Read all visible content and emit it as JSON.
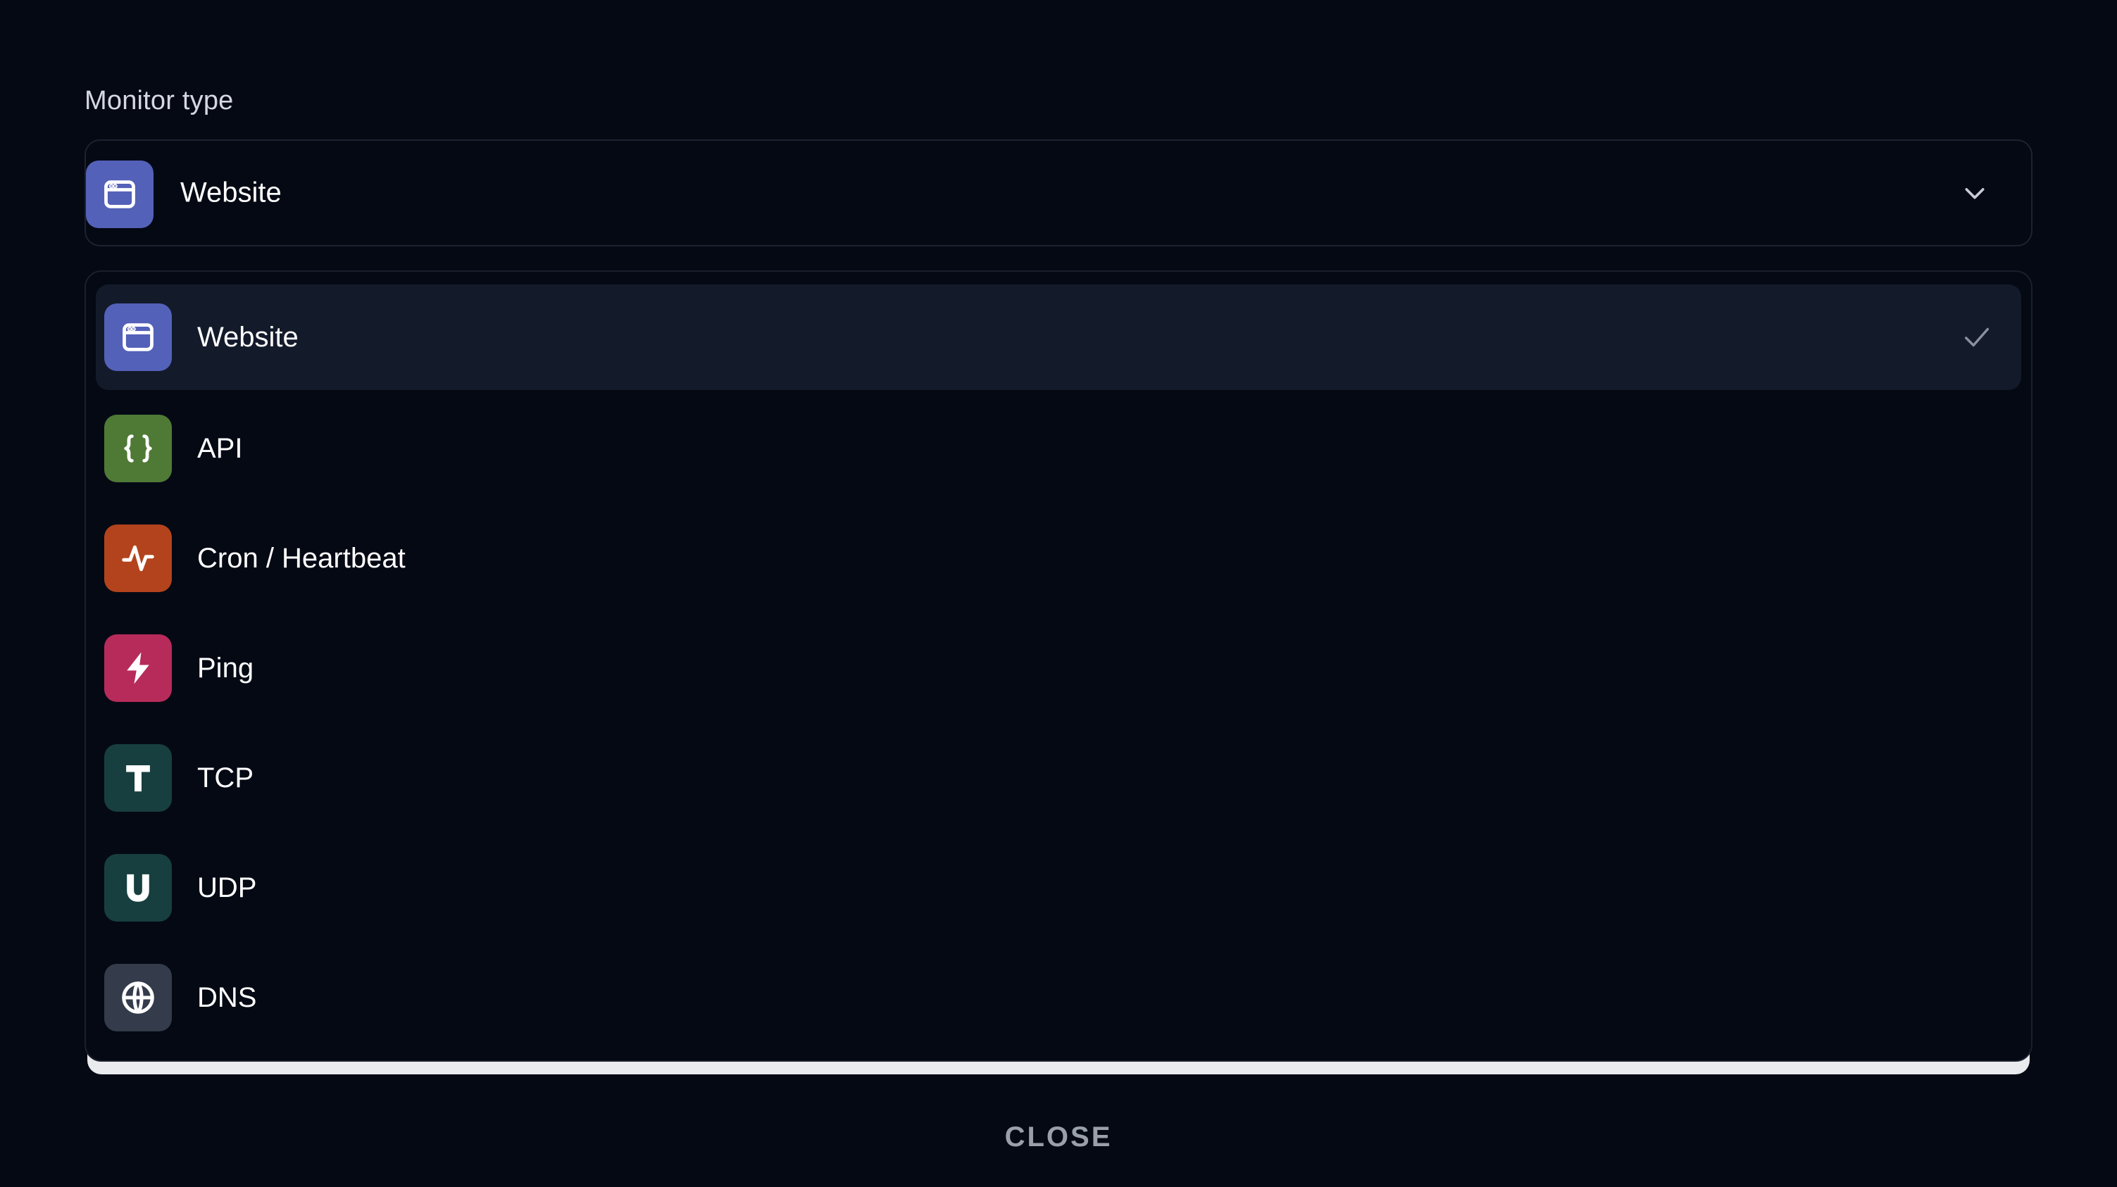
{
  "field": {
    "label": "Monitor type",
    "selected_value": "Website",
    "selected_icon": "browser-window-icon"
  },
  "options": [
    {
      "label": "Website",
      "icon": "browser-window-icon",
      "color": "#5361b8",
      "selected": true
    },
    {
      "label": "API",
      "icon": "curly-braces-icon",
      "color": "#4f7a36",
      "selected": false
    },
    {
      "label": "Cron / Heartbeat",
      "icon": "pulse-icon",
      "color": "#b3431c",
      "selected": false
    },
    {
      "label": "Ping",
      "icon": "lightning-bolt-icon",
      "color": "#b72b5a",
      "selected": false
    },
    {
      "label": "TCP",
      "icon": "letter-t-icon",
      "color": "#173f3f",
      "selected": false
    },
    {
      "label": "UDP",
      "icon": "letter-u-icon",
      "color": "#173f3f",
      "selected": false
    },
    {
      "label": "DNS",
      "icon": "globe-icon",
      "color": "#343b4b",
      "selected": false
    }
  ],
  "close_label": "CLOSE",
  "colors": {
    "background": "#050914",
    "selected_row": "#131a2a",
    "border": "#1d2230"
  }
}
